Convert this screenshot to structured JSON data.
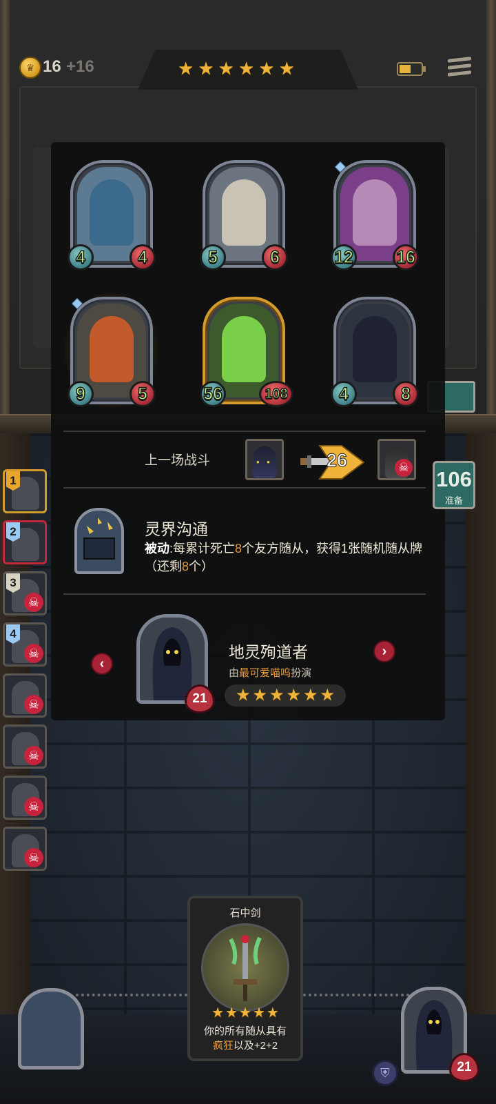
{
  "top_bar": {
    "gold": "16",
    "gold_income": "+16",
    "tier_stars": 6,
    "icons": {
      "coin": "crown-coin-icon",
      "battery": "battery-icon",
      "menu": "menu-icon"
    }
  },
  "board": {
    "units": [
      {
        "attack": "4",
        "health": "4",
        "art": "blue-dragon"
      },
      {
        "attack": "5",
        "health": "6",
        "art": "white-maned-beast"
      },
      {
        "attack": "12",
        "health": "16",
        "art": "pirate-octopus",
        "gem": true
      },
      {
        "attack": "9",
        "health": "5",
        "art": "red-hair-archer",
        "gem": true,
        "glow": true
      },
      {
        "attack": "56",
        "health": "108",
        "art": "green-slime-demon",
        "gold_frame": true
      },
      {
        "attack": "4",
        "health": "8",
        "art": "hooded-sword"
      }
    ]
  },
  "last_battle": {
    "label": "上一场战斗",
    "damage": "26",
    "result_icon": "skull-icon"
  },
  "ability": {
    "name": "灵界沟通",
    "keyword": "被动",
    "text_a": ":每累计死亡",
    "count_a": "8",
    "text_b": "个友方随从，获得1张随机随从牌（还剩",
    "count_b": "8",
    "text_c": "个）"
  },
  "character": {
    "name": "地灵殉道者",
    "by_prefix": "由",
    "player_name": "最可爱喵呜",
    "by_suffix": "扮演",
    "health": "21",
    "stars": 6
  },
  "player_list": [
    {
      "rank": "1",
      "color": "#e7a72e",
      "dead": false
    },
    {
      "rank": "2",
      "color": "#9cc9f0",
      "dead": false
    },
    {
      "rank": "3",
      "color": "#d8d2c3",
      "dead": true
    },
    {
      "rank": "4",
      "color": "#9cc9f0",
      "dead": true
    },
    {
      "rank": "",
      "dead": true
    },
    {
      "rank": "",
      "dead": true
    },
    {
      "rank": "",
      "dead": true
    },
    {
      "rank": "",
      "dead": true
    }
  ],
  "turn_counter": {
    "value": "106",
    "label": "准备"
  },
  "spell_card": {
    "title": "石中剑",
    "stars": 5,
    "desc_line1": "你的所有随从具有",
    "desc_keyword": "疯狂",
    "desc_line2": "以及+2+2"
  },
  "hero": {
    "health": "21"
  },
  "colors": {
    "star": "#f0b43a",
    "highlight": "#e79b3c",
    "atk": "#3b7e86",
    "hp": "#a32733"
  }
}
